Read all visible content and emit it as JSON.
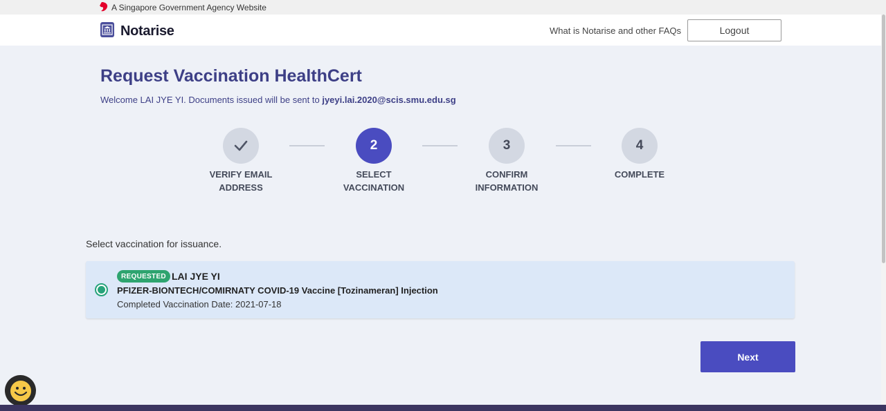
{
  "gov_banner": {
    "text": "A Singapore Government Agency Website"
  },
  "header": {
    "logo_text": "Notarise",
    "faq_link": "What is Notarise and other FAQs",
    "logout_label": "Logout"
  },
  "page": {
    "title": "Request Vaccination HealthCert",
    "welcome_prefix": "Welcome LAI JYE YI. Documents issued will be sent to ",
    "email": "jyeyi.lai.2020@scis.smu.edu.sg"
  },
  "stepper": {
    "steps": [
      {
        "number": "✓",
        "label_line1": "VERIFY EMAIL",
        "label_line2": "ADDRESS",
        "state": "completed"
      },
      {
        "number": "2",
        "label_line1": "SELECT",
        "label_line2": "VACCINATION",
        "state": "active"
      },
      {
        "number": "3",
        "label_line1": "CONFIRM",
        "label_line2": "INFORMATION",
        "state": "pending"
      },
      {
        "number": "4",
        "label_line1": "COMPLETE",
        "label_line2": "",
        "state": "pending"
      }
    ]
  },
  "selection": {
    "prompt": "Select vaccination for issuance.",
    "card": {
      "badge": "REQUESTED",
      "name": "LAI JYE YI",
      "vaccine": "PFIZER-BIONTECH/COMIRNATY COVID-19 Vaccine [Tozinameran] Injection",
      "date": "Completed Vaccination Date: 2021-07-18",
      "selected": true
    }
  },
  "actions": {
    "next_label": "Next"
  },
  "colors": {
    "primary": "#4a4cc0",
    "title": "#3d3f86",
    "success": "#2ea46f",
    "card_bg": "#dce8f8",
    "page_bg": "#eef1f7",
    "footer": "#3b3560"
  },
  "icons": {
    "gov": "lion-head-icon",
    "logo": "notarise-logo-icon",
    "chat": "smiley-icon"
  }
}
